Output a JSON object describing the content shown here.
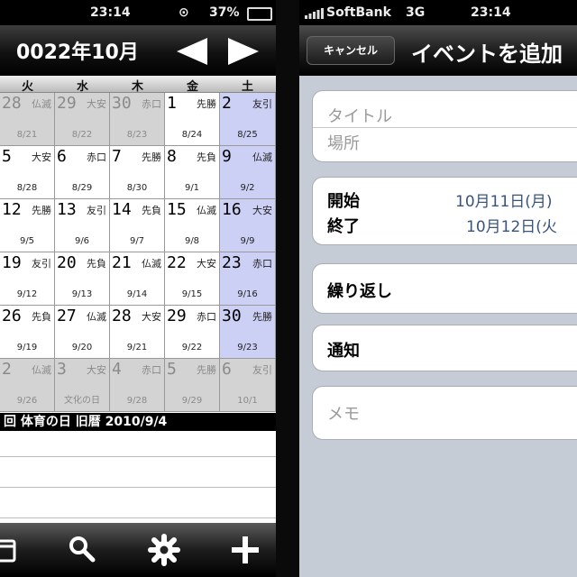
{
  "left_phone": {
    "status": {
      "time": "23:14",
      "battery": "37%"
    },
    "month_title": "0022年10月",
    "weekdays": [
      "火",
      "水",
      "木",
      "金",
      "土"
    ],
    "weeks": [
      [
        {
          "d": "28",
          "r": "仏滅",
          "l": "8/21",
          "t": "gray"
        },
        {
          "d": "29",
          "r": "大安",
          "l": "8/22",
          "t": "gray"
        },
        {
          "d": "30",
          "r": "赤口",
          "l": "8/23",
          "t": "gray"
        },
        {
          "d": "1",
          "r": "先勝",
          "l": "8/24",
          "t": "normal"
        },
        {
          "d": "2",
          "r": "友引",
          "l": "8/25",
          "t": "sat"
        }
      ],
      [
        {
          "d": "5",
          "r": "大安",
          "l": "8/28",
          "t": "normal"
        },
        {
          "d": "6",
          "r": "赤口",
          "l": "8/29",
          "t": "normal"
        },
        {
          "d": "7",
          "r": "先勝",
          "l": "8/30",
          "t": "normal"
        },
        {
          "d": "8",
          "r": "先負",
          "l": "9/1",
          "t": "normal"
        },
        {
          "d": "9",
          "r": "仏滅",
          "l": "9/2",
          "t": "sat"
        }
      ],
      [
        {
          "d": "12",
          "r": "先勝",
          "l": "9/5",
          "t": "normal"
        },
        {
          "d": "13",
          "r": "友引",
          "l": "9/6",
          "t": "normal"
        },
        {
          "d": "14",
          "r": "先負",
          "l": "9/7",
          "t": "normal"
        },
        {
          "d": "15",
          "r": "仏滅",
          "l": "9/8",
          "t": "normal"
        },
        {
          "d": "16",
          "r": "大安",
          "l": "9/9",
          "t": "sat"
        }
      ],
      [
        {
          "d": "19",
          "r": "友引",
          "l": "9/12",
          "t": "normal"
        },
        {
          "d": "20",
          "r": "先負",
          "l": "9/13",
          "t": "normal"
        },
        {
          "d": "21",
          "r": "仏滅",
          "l": "9/14",
          "t": "normal"
        },
        {
          "d": "22",
          "r": "大安",
          "l": "9/15",
          "t": "normal"
        },
        {
          "d": "23",
          "r": "赤口",
          "l": "9/16",
          "t": "sat"
        }
      ],
      [
        {
          "d": "26",
          "r": "先負",
          "l": "9/19",
          "t": "normal"
        },
        {
          "d": "27",
          "r": "仏滅",
          "l": "9/20",
          "t": "normal"
        },
        {
          "d": "28",
          "r": "大安",
          "l": "9/21",
          "t": "normal"
        },
        {
          "d": "29",
          "r": "赤口",
          "l": "9/22",
          "t": "normal"
        },
        {
          "d": "30",
          "r": "先勝",
          "l": "9/23",
          "t": "sat"
        }
      ],
      [
        {
          "d": "2",
          "r": "仏滅",
          "l": "9/26",
          "t": "gray"
        },
        {
          "d": "3",
          "r": "大安",
          "l": "文化の日",
          "t": "gray"
        },
        {
          "d": "4",
          "r": "赤口",
          "l": "9/28",
          "t": "gray"
        },
        {
          "d": "5",
          "r": "先勝",
          "l": "9/29",
          "t": "gray"
        },
        {
          "d": "6",
          "r": "友引",
          "l": "10/1",
          "t": "gray"
        }
      ]
    ],
    "info_bar": "回 体育の日 旧暦 2010/9/4",
    "toolbar_icons": [
      "calendar-icon",
      "search-icon",
      "gear-icon",
      "plus-icon"
    ]
  },
  "right_phone": {
    "status": {
      "carrier": "SoftBank",
      "network": "3G",
      "time": "23:14"
    },
    "cancel_label": "キャンセル",
    "nav_title": "イベントを追加",
    "title_placeholder": "タイトル",
    "location_placeholder": "場所",
    "start_label": "開始",
    "start_value": "10月11日(月)",
    "end_label": "終了",
    "end_value": "10月12日(火",
    "repeat_label": "繰り返し",
    "alert_label": "通知",
    "memo_placeholder": "メモ"
  }
}
